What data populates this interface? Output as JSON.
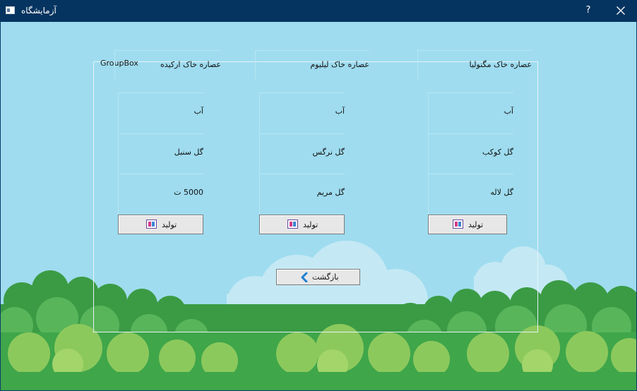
{
  "window": {
    "title": "آزمایشگاه",
    "help_label": "?",
    "icon": "app-window-icon"
  },
  "groupbox": {
    "title": "GroupBox"
  },
  "columns": [
    {
      "header": "عصاره خاک مگنولیا",
      "rows": [
        "آب",
        "گل کوکب",
        "گل لاله"
      ],
      "button_label": "تولید"
    },
    {
      "header": "عصاره خاک لیلیوم",
      "rows": [
        "آب",
        "گل نرگس",
        "گل مریم"
      ],
      "button_label": "تولید"
    },
    {
      "header": "عصاره خاک ارکیده",
      "rows": [
        "آب",
        "گل سنبل",
        "5000 ت"
      ],
      "button_label": "تولید"
    }
  ],
  "back_button": {
    "label": "بازگشت",
    "icon": "chevron-left-icon"
  },
  "colors": {
    "titlebar": "#053460",
    "sky": "#9fdcef",
    "grass": "#3fa64a",
    "accent_icon": "#1e7fd0"
  }
}
